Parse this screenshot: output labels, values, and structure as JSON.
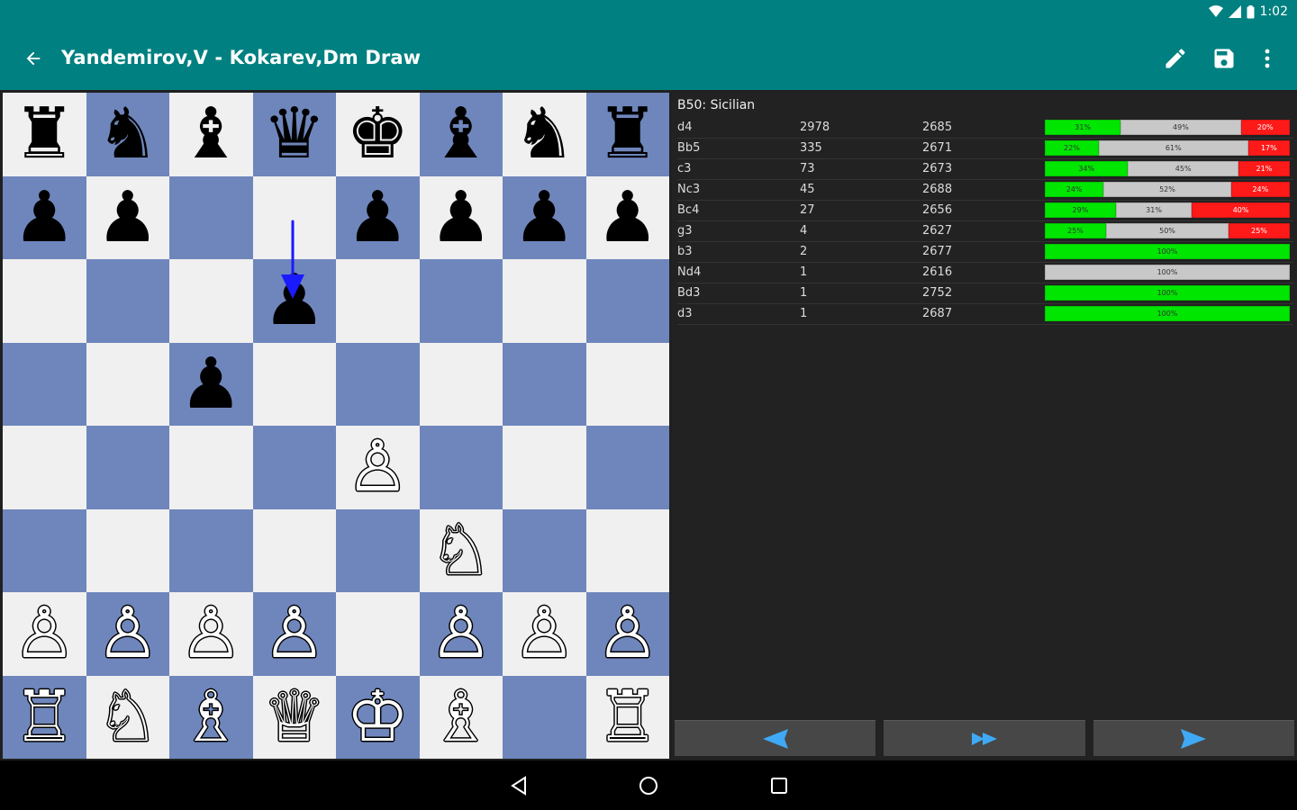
{
  "status_bar": {
    "time": "1:02"
  },
  "app_bar": {
    "title": "Yandemirov,V - Kokarev,Dm Draw",
    "icons": {
      "back": "back-arrow-icon",
      "edit": "pencil-icon",
      "save": "save-icon",
      "more": "more-vert-icon"
    }
  },
  "board": {
    "rows": [
      [
        "♜",
        "♞",
        "♝",
        "♛",
        "♚",
        "♝",
        "♞",
        "♜"
      ],
      [
        "♟",
        "♟",
        "",
        "",
        "♟",
        "♟",
        "♟",
        "♟"
      ],
      [
        "",
        "",
        "",
        "♟",
        "",
        "",
        "",
        ""
      ],
      [
        "",
        "",
        "♟",
        "",
        "",
        "",
        "",
        ""
      ],
      [
        "",
        "",
        "",
        "",
        "♙",
        "",
        "",
        ""
      ],
      [
        "",
        "",
        "",
        "",
        "",
        "♘",
        "",
        ""
      ],
      [
        "♙",
        "♙",
        "♙",
        "♙",
        "",
        "♙",
        "♙",
        "♙"
      ],
      [
        "♖",
        "♘",
        "♗",
        "♕",
        "♔",
        "♗",
        "",
        "♖"
      ]
    ],
    "colors": {
      "light": "#f0f0f0",
      "dark": "#6f86bc",
      "arrow": "#1a1aff"
    },
    "last_move_arrow": {
      "from": "d7",
      "to": "d6"
    }
  },
  "opening": {
    "name": "B50: Sicilian"
  },
  "book_moves": [
    {
      "move": "d4",
      "count": "2978",
      "elo": "2685",
      "win": 31,
      "draw": 49,
      "loss": 20,
      "win_label": "31%",
      "draw_label": "49%",
      "loss_label": "20%"
    },
    {
      "move": "Bb5",
      "count": "335",
      "elo": "2671",
      "win": 22,
      "draw": 61,
      "loss": 17,
      "win_label": "22%",
      "draw_label": "61%",
      "loss_label": "17%"
    },
    {
      "move": "c3",
      "count": "73",
      "elo": "2673",
      "win": 34,
      "draw": 45,
      "loss": 21,
      "win_label": "34%",
      "draw_label": "45%",
      "loss_label": "21%"
    },
    {
      "move": "Nc3",
      "count": "45",
      "elo": "2688",
      "win": 24,
      "draw": 52,
      "loss": 24,
      "win_label": "24%",
      "draw_label": "52%",
      "loss_label": "24%"
    },
    {
      "move": "Bc4",
      "count": "27",
      "elo": "2656",
      "win": 29,
      "draw": 31,
      "loss": 40,
      "win_label": "29%",
      "draw_label": "31%",
      "loss_label": "40%"
    },
    {
      "move": "g3",
      "count": "4",
      "elo": "2627",
      "win": 25,
      "draw": 50,
      "loss": 25,
      "win_label": "25%",
      "draw_label": "50%",
      "loss_label": "25%"
    },
    {
      "move": "b3",
      "count": "2",
      "elo": "2677",
      "win": 100,
      "draw": 0,
      "loss": 0,
      "win_label": "100%",
      "draw_label": "",
      "loss_label": ""
    },
    {
      "move": "Nd4",
      "count": "1",
      "elo": "2616",
      "win": 0,
      "draw": 100,
      "loss": 0,
      "win_label": "",
      "draw_label": "100%",
      "loss_label": ""
    },
    {
      "move": "Bd3",
      "count": "1",
      "elo": "2752",
      "win": 100,
      "draw": 0,
      "loss": 0,
      "win_label": "100%",
      "draw_label": "",
      "loss_label": ""
    },
    {
      "move": "d3",
      "count": "1",
      "elo": "2687",
      "win": 100,
      "draw": 0,
      "loss": 0,
      "win_label": "100%",
      "draw_label": "",
      "loss_label": ""
    }
  ],
  "nav_buttons": {
    "back": "triangle-left-icon",
    "fast_forward": "double-triangle-right-icon",
    "forward": "triangle-right-icon"
  },
  "system_nav": {
    "back": "nav-back-icon",
    "home": "nav-home-icon",
    "recents": "nav-recents-icon"
  },
  "colors": {
    "teal": "#008080",
    "win": "#00e600",
    "draw": "#c8c8c8",
    "loss": "#ff1a1a",
    "nav_arrow": "#3fa9f5"
  }
}
